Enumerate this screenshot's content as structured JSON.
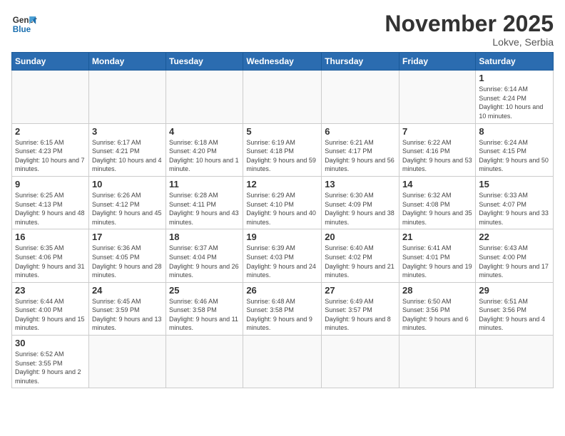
{
  "logo": {
    "general": "General",
    "blue": "Blue"
  },
  "header": {
    "month": "November 2025",
    "location": "Lokve, Serbia"
  },
  "weekdays": [
    "Sunday",
    "Monday",
    "Tuesday",
    "Wednesday",
    "Thursday",
    "Friday",
    "Saturday"
  ],
  "weeks": [
    [
      {
        "day": "",
        "info": ""
      },
      {
        "day": "",
        "info": ""
      },
      {
        "day": "",
        "info": ""
      },
      {
        "day": "",
        "info": ""
      },
      {
        "day": "",
        "info": ""
      },
      {
        "day": "",
        "info": ""
      },
      {
        "day": "1",
        "info": "Sunrise: 6:14 AM\nSunset: 4:24 PM\nDaylight: 10 hours and 10 minutes."
      }
    ],
    [
      {
        "day": "2",
        "info": "Sunrise: 6:15 AM\nSunset: 4:23 PM\nDaylight: 10 hours and 7 minutes."
      },
      {
        "day": "3",
        "info": "Sunrise: 6:17 AM\nSunset: 4:21 PM\nDaylight: 10 hours and 4 minutes."
      },
      {
        "day": "4",
        "info": "Sunrise: 6:18 AM\nSunset: 4:20 PM\nDaylight: 10 hours and 1 minute."
      },
      {
        "day": "5",
        "info": "Sunrise: 6:19 AM\nSunset: 4:18 PM\nDaylight: 9 hours and 59 minutes."
      },
      {
        "day": "6",
        "info": "Sunrise: 6:21 AM\nSunset: 4:17 PM\nDaylight: 9 hours and 56 minutes."
      },
      {
        "day": "7",
        "info": "Sunrise: 6:22 AM\nSunset: 4:16 PM\nDaylight: 9 hours and 53 minutes."
      },
      {
        "day": "8",
        "info": "Sunrise: 6:24 AM\nSunset: 4:15 PM\nDaylight: 9 hours and 50 minutes."
      }
    ],
    [
      {
        "day": "9",
        "info": "Sunrise: 6:25 AM\nSunset: 4:13 PM\nDaylight: 9 hours and 48 minutes."
      },
      {
        "day": "10",
        "info": "Sunrise: 6:26 AM\nSunset: 4:12 PM\nDaylight: 9 hours and 45 minutes."
      },
      {
        "day": "11",
        "info": "Sunrise: 6:28 AM\nSunset: 4:11 PM\nDaylight: 9 hours and 43 minutes."
      },
      {
        "day": "12",
        "info": "Sunrise: 6:29 AM\nSunset: 4:10 PM\nDaylight: 9 hours and 40 minutes."
      },
      {
        "day": "13",
        "info": "Sunrise: 6:30 AM\nSunset: 4:09 PM\nDaylight: 9 hours and 38 minutes."
      },
      {
        "day": "14",
        "info": "Sunrise: 6:32 AM\nSunset: 4:08 PM\nDaylight: 9 hours and 35 minutes."
      },
      {
        "day": "15",
        "info": "Sunrise: 6:33 AM\nSunset: 4:07 PM\nDaylight: 9 hours and 33 minutes."
      }
    ],
    [
      {
        "day": "16",
        "info": "Sunrise: 6:35 AM\nSunset: 4:06 PM\nDaylight: 9 hours and 31 minutes."
      },
      {
        "day": "17",
        "info": "Sunrise: 6:36 AM\nSunset: 4:05 PM\nDaylight: 9 hours and 28 minutes."
      },
      {
        "day": "18",
        "info": "Sunrise: 6:37 AM\nSunset: 4:04 PM\nDaylight: 9 hours and 26 minutes."
      },
      {
        "day": "19",
        "info": "Sunrise: 6:39 AM\nSunset: 4:03 PM\nDaylight: 9 hours and 24 minutes."
      },
      {
        "day": "20",
        "info": "Sunrise: 6:40 AM\nSunset: 4:02 PM\nDaylight: 9 hours and 21 minutes."
      },
      {
        "day": "21",
        "info": "Sunrise: 6:41 AM\nSunset: 4:01 PM\nDaylight: 9 hours and 19 minutes."
      },
      {
        "day": "22",
        "info": "Sunrise: 6:43 AM\nSunset: 4:00 PM\nDaylight: 9 hours and 17 minutes."
      }
    ],
    [
      {
        "day": "23",
        "info": "Sunrise: 6:44 AM\nSunset: 4:00 PM\nDaylight: 9 hours and 15 minutes."
      },
      {
        "day": "24",
        "info": "Sunrise: 6:45 AM\nSunset: 3:59 PM\nDaylight: 9 hours and 13 minutes."
      },
      {
        "day": "25",
        "info": "Sunrise: 6:46 AM\nSunset: 3:58 PM\nDaylight: 9 hours and 11 minutes."
      },
      {
        "day": "26",
        "info": "Sunrise: 6:48 AM\nSunset: 3:58 PM\nDaylight: 9 hours and 9 minutes."
      },
      {
        "day": "27",
        "info": "Sunrise: 6:49 AM\nSunset: 3:57 PM\nDaylight: 9 hours and 8 minutes."
      },
      {
        "day": "28",
        "info": "Sunrise: 6:50 AM\nSunset: 3:56 PM\nDaylight: 9 hours and 6 minutes."
      },
      {
        "day": "29",
        "info": "Sunrise: 6:51 AM\nSunset: 3:56 PM\nDaylight: 9 hours and 4 minutes."
      }
    ],
    [
      {
        "day": "30",
        "info": "Sunrise: 6:52 AM\nSunset: 3:55 PM\nDaylight: 9 hours and 2 minutes."
      },
      {
        "day": "",
        "info": ""
      },
      {
        "day": "",
        "info": ""
      },
      {
        "day": "",
        "info": ""
      },
      {
        "day": "",
        "info": ""
      },
      {
        "day": "",
        "info": ""
      },
      {
        "day": "",
        "info": ""
      }
    ]
  ]
}
